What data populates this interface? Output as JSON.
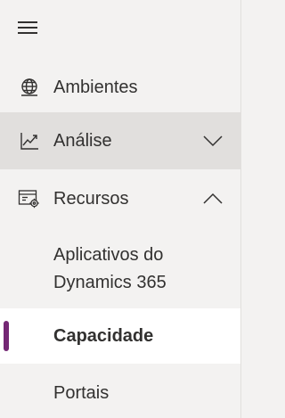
{
  "menu": {
    "toggle_icon": "hamburger-icon"
  },
  "items": {
    "ambientes": {
      "label": "Ambientes",
      "icon": "globe-icon"
    },
    "analise": {
      "label": "Análise",
      "icon": "chart-line-icon",
      "expanded": false,
      "chevron": "chevron-down-icon"
    },
    "recursos": {
      "label": "Recursos",
      "icon": "settings-window-icon",
      "expanded": true,
      "chevron": "chevron-up-icon"
    }
  },
  "subitems": {
    "aplicativos": {
      "label": "Aplicativos do Dynamics 365"
    },
    "capacidade": {
      "label": "Capacidade",
      "selected": true
    },
    "portais": {
      "label": "Portais"
    }
  },
  "colors": {
    "background": "#f3f2f1",
    "hover": "#e1dfdd",
    "selected_bg": "#ffffff",
    "accent": "#742774",
    "text": "#323130"
  }
}
